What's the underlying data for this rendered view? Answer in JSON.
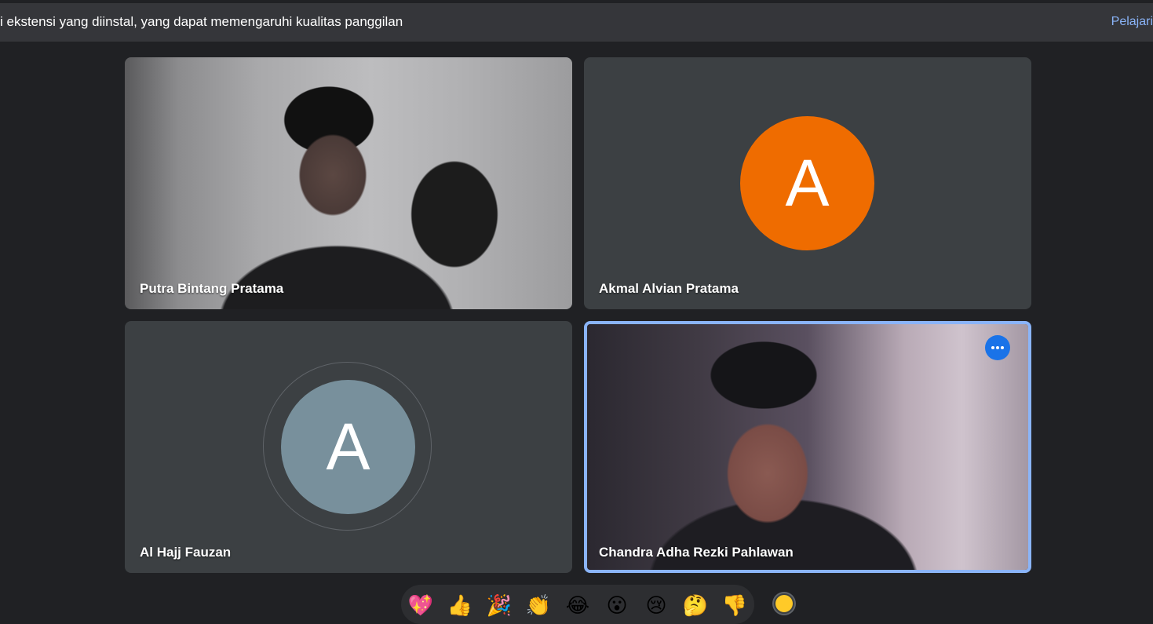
{
  "banner": {
    "text": "i ekstensi yang diinstal, yang dapat memengaruhi kualitas panggilan",
    "link": "Pelajari"
  },
  "participants": [
    {
      "name": "Putra Bintang Pratama",
      "video": true
    },
    {
      "name": "Akmal Alvian Pratama",
      "initial": "A",
      "avatar_color": "#ef6c00"
    },
    {
      "name": "Al Hajj Fauzan",
      "initial": "A",
      "avatar_color": "#78909c"
    },
    {
      "name": "Chandra Adha Rezki Pahlawan",
      "video": true,
      "active_speaker": true
    }
  ],
  "colors": {
    "background": "#202124",
    "tile": "#3c4043",
    "accent": "#8ab4f8",
    "more_button": "#1a73e8"
  },
  "reactions": [
    "💖",
    "👍",
    "🎉",
    "👏",
    "😂",
    "😮",
    "😢",
    "🤔",
    "👎"
  ],
  "skin_tone_color": "#ffca28"
}
